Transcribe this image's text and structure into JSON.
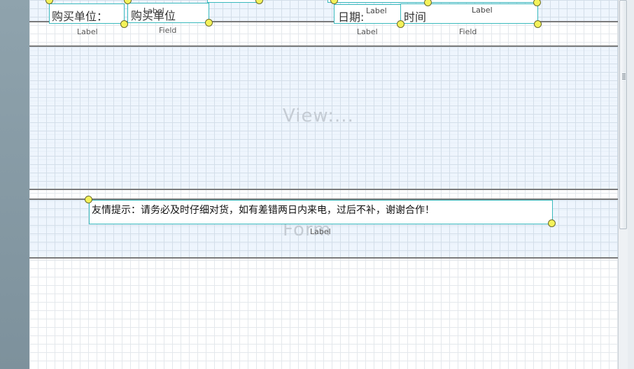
{
  "bands": {
    "detail": {
      "watermark": "View:..."
    },
    "footer": {
      "watermark": "Form"
    }
  },
  "header_fields": {
    "buyer_label": {
      "text": "购买单位：",
      "tag": "Label"
    },
    "buyer_field": {
      "text": "购买单位",
      "overlap_text": "Label",
      "tag": "Field"
    },
    "date_label": {
      "text": "日期:",
      "overlap_text": "Label",
      "tag": "Label"
    },
    "time_field": {
      "text": "时间",
      "overlap_text": "Label",
      "tag": "Field"
    }
  },
  "footer_note": {
    "text": "友情提示：请务必及时仔细对货，如有差错两日内来电，过后不补，谢谢合作！",
    "tag": "Label"
  },
  "colors": {
    "selection_border": "#39b9bd",
    "handle_fill": "#f4f25a",
    "band_fill": "#e8f2fc"
  }
}
